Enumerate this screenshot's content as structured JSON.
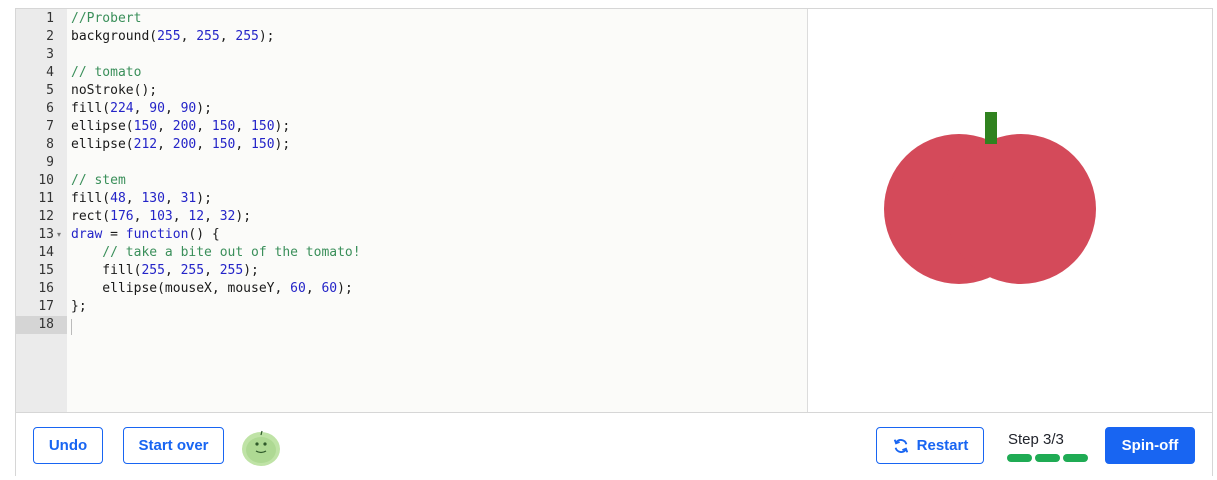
{
  "editor": {
    "lines": [
      {
        "num": "1",
        "tokens": [
          {
            "t": "//Probert",
            "c": "comment"
          }
        ]
      },
      {
        "num": "2",
        "tokens": [
          {
            "t": "background(",
            "c": "plain"
          },
          {
            "t": "255",
            "c": "num"
          },
          {
            "t": ", ",
            "c": "plain"
          },
          {
            "t": "255",
            "c": "num"
          },
          {
            "t": ", ",
            "c": "plain"
          },
          {
            "t": "255",
            "c": "num"
          },
          {
            "t": ");",
            "c": "plain"
          }
        ]
      },
      {
        "num": "3",
        "tokens": []
      },
      {
        "num": "4",
        "tokens": [
          {
            "t": "// tomato",
            "c": "comment"
          }
        ]
      },
      {
        "num": "5",
        "tokens": [
          {
            "t": "noStroke();",
            "c": "plain"
          }
        ]
      },
      {
        "num": "6",
        "tokens": [
          {
            "t": "fill(",
            "c": "plain"
          },
          {
            "t": "224",
            "c": "num"
          },
          {
            "t": ", ",
            "c": "plain"
          },
          {
            "t": "90",
            "c": "num"
          },
          {
            "t": ", ",
            "c": "plain"
          },
          {
            "t": "90",
            "c": "num"
          },
          {
            "t": ");",
            "c": "plain"
          }
        ]
      },
      {
        "num": "7",
        "tokens": [
          {
            "t": "ellipse(",
            "c": "plain"
          },
          {
            "t": "150",
            "c": "num"
          },
          {
            "t": ", ",
            "c": "plain"
          },
          {
            "t": "200",
            "c": "num"
          },
          {
            "t": ", ",
            "c": "plain"
          },
          {
            "t": "150",
            "c": "num"
          },
          {
            "t": ", ",
            "c": "plain"
          },
          {
            "t": "150",
            "c": "num"
          },
          {
            "t": ");",
            "c": "plain"
          }
        ]
      },
      {
        "num": "8",
        "tokens": [
          {
            "t": "ellipse(",
            "c": "plain"
          },
          {
            "t": "212",
            "c": "num"
          },
          {
            "t": ", ",
            "c": "plain"
          },
          {
            "t": "200",
            "c": "num"
          },
          {
            "t": ", ",
            "c": "plain"
          },
          {
            "t": "150",
            "c": "num"
          },
          {
            "t": ", ",
            "c": "plain"
          },
          {
            "t": "150",
            "c": "num"
          },
          {
            "t": ");",
            "c": "plain"
          }
        ]
      },
      {
        "num": "9",
        "tokens": []
      },
      {
        "num": "10",
        "tokens": [
          {
            "t": "// stem",
            "c": "comment"
          }
        ]
      },
      {
        "num": "11",
        "tokens": [
          {
            "t": "fill(",
            "c": "plain"
          },
          {
            "t": "48",
            "c": "num"
          },
          {
            "t": ", ",
            "c": "plain"
          },
          {
            "t": "130",
            "c": "num"
          },
          {
            "t": ", ",
            "c": "plain"
          },
          {
            "t": "31",
            "c": "num"
          },
          {
            "t": ");",
            "c": "plain"
          }
        ]
      },
      {
        "num": "12",
        "tokens": [
          {
            "t": "rect(",
            "c": "plain"
          },
          {
            "t": "176",
            "c": "num"
          },
          {
            "t": ", ",
            "c": "plain"
          },
          {
            "t": "103",
            "c": "num"
          },
          {
            "t": ", ",
            "c": "plain"
          },
          {
            "t": "12",
            "c": "num"
          },
          {
            "t": ", ",
            "c": "plain"
          },
          {
            "t": "32",
            "c": "num"
          },
          {
            "t": ");",
            "c": "plain"
          }
        ]
      },
      {
        "num": "13",
        "fold": true,
        "tokens": [
          {
            "t": "draw",
            "c": "kw"
          },
          {
            "t": " = ",
            "c": "plain"
          },
          {
            "t": "function",
            "c": "kw"
          },
          {
            "t": "() {",
            "c": "plain"
          }
        ]
      },
      {
        "num": "14",
        "tokens": [
          {
            "t": "    // take a bite out of the tomato!",
            "c": "comment"
          }
        ]
      },
      {
        "num": "15",
        "tokens": [
          {
            "t": "    fill(",
            "c": "plain"
          },
          {
            "t": "255",
            "c": "num"
          },
          {
            "t": ", ",
            "c": "plain"
          },
          {
            "t": "255",
            "c": "num"
          },
          {
            "t": ", ",
            "c": "plain"
          },
          {
            "t": "255",
            "c": "num"
          },
          {
            "t": ");",
            "c": "plain"
          }
        ]
      },
      {
        "num": "16",
        "tokens": [
          {
            "t": "    ellipse(mouseX, mouseY, ",
            "c": "plain"
          },
          {
            "t": "60",
            "c": "num"
          },
          {
            "t": ", ",
            "c": "plain"
          },
          {
            "t": "60",
            "c": "num"
          },
          {
            "t": ");",
            "c": "plain"
          }
        ]
      },
      {
        "num": "17",
        "tokens": [
          {
            "t": "};",
            "c": "plain"
          }
        ]
      },
      {
        "num": "18",
        "active": true,
        "tokens": []
      }
    ]
  },
  "canvas": {
    "tomato_color": "#d44a5a",
    "stem_color": "#30821f"
  },
  "toolbar": {
    "undo_label": "Undo",
    "start_over_label": "Start over",
    "restart_label": "Restart",
    "step_label": "Step 3/3",
    "spinoff_label": "Spin-off",
    "progress": {
      "completed": 3,
      "total": 3,
      "color": "#1fab54"
    }
  },
  "colors": {
    "accent": "#1865f2"
  }
}
